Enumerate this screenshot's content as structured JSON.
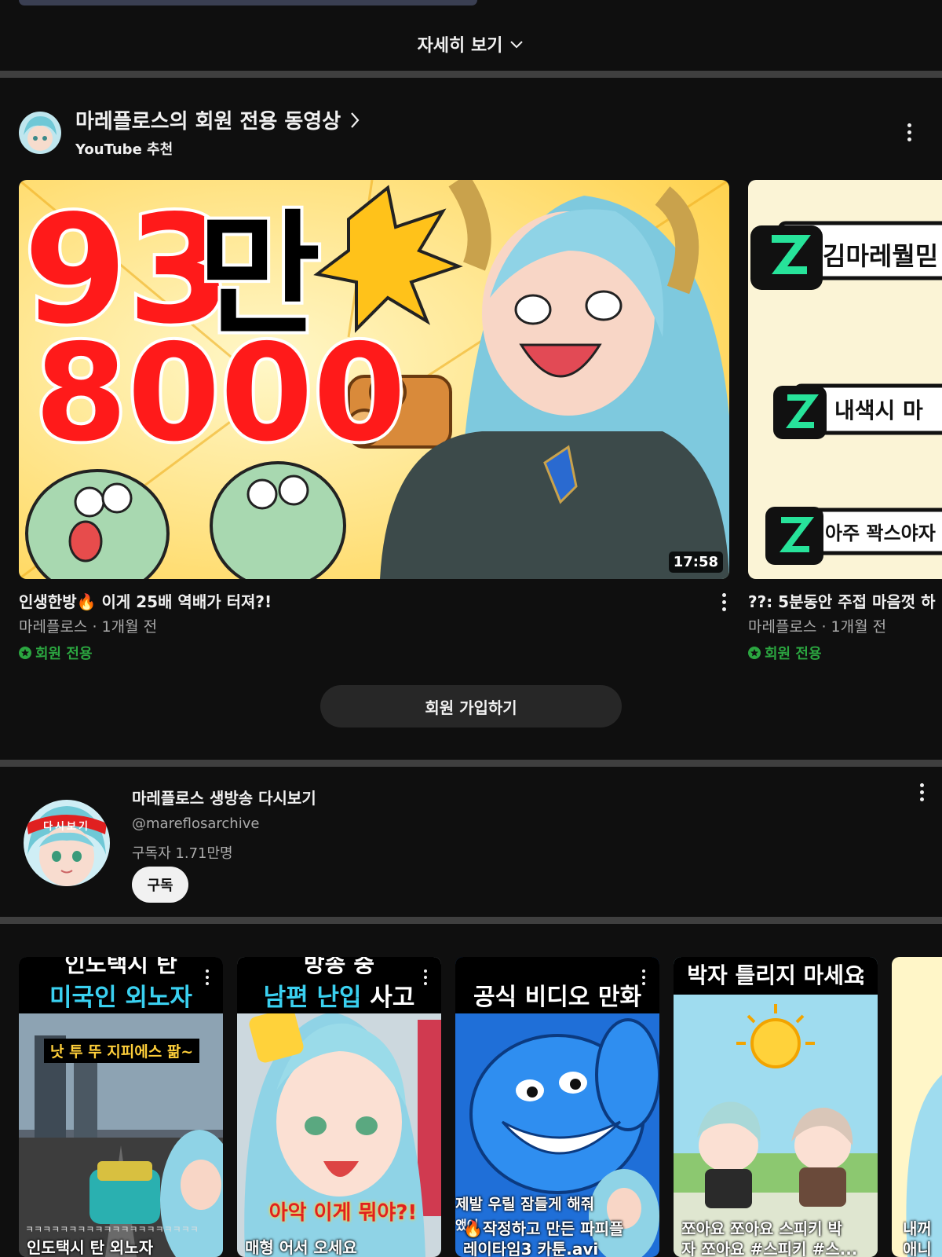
{
  "more": {
    "label": "자세히 보기"
  },
  "members_section": {
    "title": "마레플로스의 회원 전용 동영상",
    "subtitle": "YouTube 추천",
    "join_label": "회원 가입하기",
    "videos": [
      {
        "title": "인생한방🔥 이게 25배 역배가 터져?!",
        "meta": "마레플로스 · 1개월 전",
        "badge": "회원 전용",
        "duration": "17:58",
        "thumb_text": {
          "big1": "93",
          "big2": "만",
          "big3": "8000"
        }
      },
      {
        "title": "??: 5분동안 주접 마음껏 하",
        "meta": "마레플로스 · 1개월 전",
        "badge": "회원 전용",
        "thumb_text": {
          "line1": "김마레뭘믿",
          "line2": "내색시 마",
          "line3": "아주 꽉스야자"
        }
      }
    ]
  },
  "channel": {
    "name": "마레플로스 생방송 다시보기",
    "handle": "@mareflosarchive",
    "subscribers": "구독자 1.71만명",
    "subscribe_label": "구독",
    "avatar_banner": "다시보기"
  },
  "shorts": [
    {
      "top1": "인도택시 탄",
      "top2": "미국인 외노자",
      "top2_color": "#3ad0f0",
      "overlay": "낫 투 뚜 지피에스 팖~",
      "overlay2": "ㅋㅋㅋㅋㅋㅋㅋㅋㅋㅋㅋㅋㅋㅋㅋㅋㅋㅋㅋㅋ",
      "caption": "인도택시 탄 외노자"
    },
    {
      "top1": "방송 중",
      "top2a": "남편 난입",
      "top2b": " 사고",
      "top2_color": "#3ad0f0",
      "overlay": "아악 이게 뭐야?!",
      "caption": "매형 어서 오세요"
    },
    {
      "top1": "",
      "top2": "공식 비디오 만화",
      "top2_color": "#ffffff",
      "overlay": "제발 우릴 잠들게 해줘",
      "overlay2": "앴어",
      "caption_pre": "🔥작정하고 만든 파피플",
      "caption": "레이타임3 카툰.avi"
    },
    {
      "top2": "박자 틀리지 마세요",
      "top2_color": "#ffffff",
      "caption_pre": "쪼아요 쪼아요 스피키 박",
      "caption": "자 쪼아요  #스피키 #스..."
    },
    {
      "caption_pre": "내꺼",
      "caption": "애니"
    }
  ],
  "colors": {
    "bg": "#0f0f0f",
    "divider": "#3f3f3f",
    "member_green": "#2ba640",
    "button_dark": "#272727"
  }
}
